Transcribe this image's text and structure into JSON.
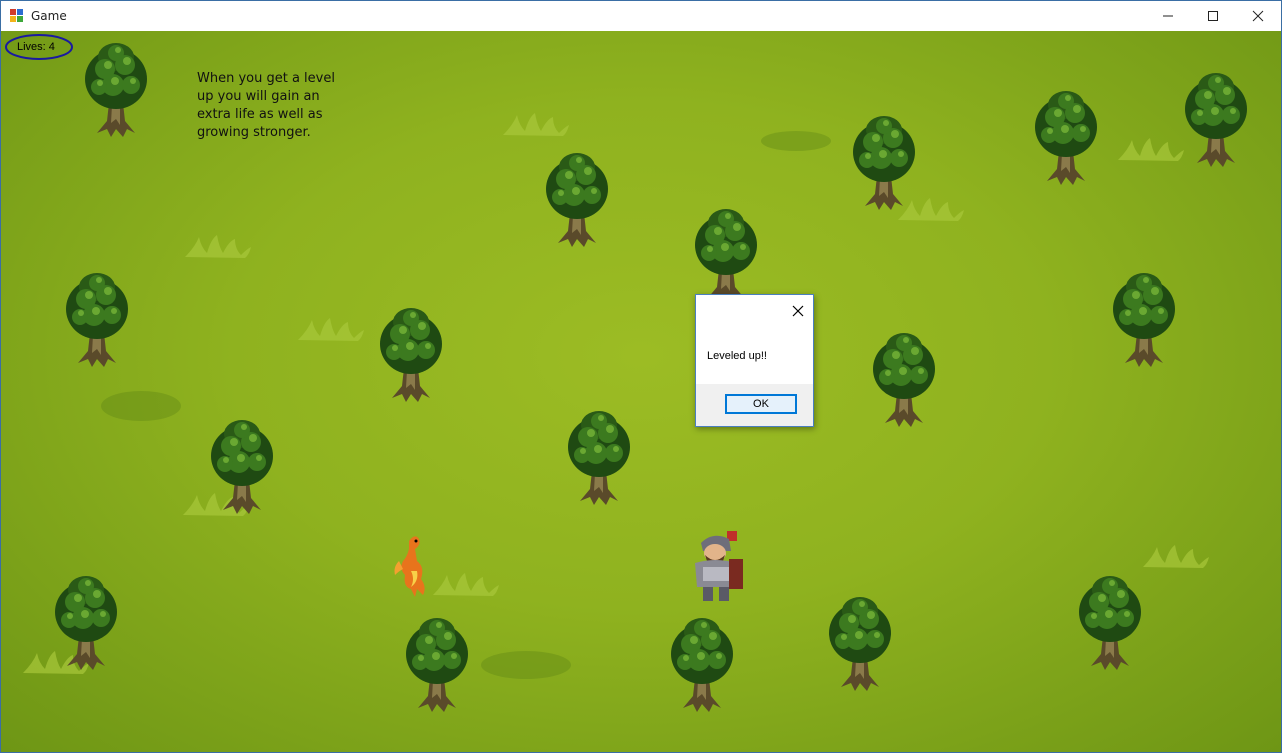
{
  "window": {
    "title": "Game",
    "minimize_icon": "minimize-icon",
    "maximize_icon": "maximize-icon",
    "close_icon": "close-icon"
  },
  "hud": {
    "lives": "Lives: 4",
    "tip": "When you get a level up you will gain an extra life as well as growing stronger."
  },
  "dialog": {
    "message": "Leveled up!!",
    "ok_label": "OK"
  },
  "sprites": {
    "tree_icon": "tree-icon",
    "dragon_icon": "dragon-icon",
    "knight_icon": "knight-icon"
  },
  "colors": {
    "grass": "#8fb21f",
    "outline": "#1a1aa0",
    "accent": "#0078d7"
  }
}
